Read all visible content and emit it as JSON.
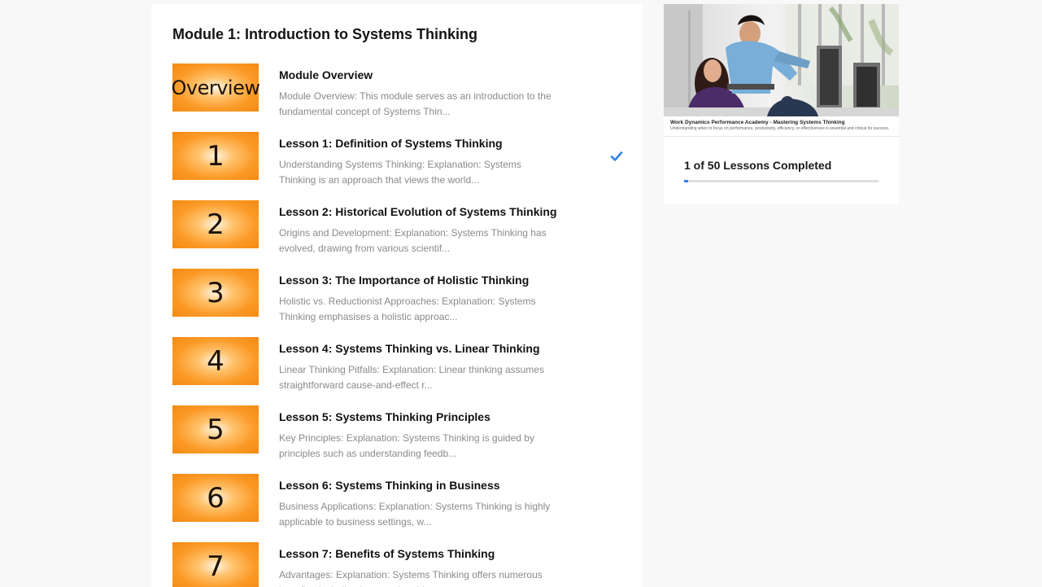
{
  "module": {
    "title": "Module 1: Introduction to Systems Thinking"
  },
  "lessons": [
    {
      "thumb_label": "Overview",
      "title": "Module Overview",
      "description": "Module Overview: This module serves as an introduction to the fundamental concept of Systems Thin...",
      "completed": false
    },
    {
      "thumb_label": "1",
      "title": "Lesson 1: Definition of Systems Thinking",
      "description": "Understanding Systems Thinking: Explanation: Systems Thinking is an approach that views the world...",
      "completed": true
    },
    {
      "thumb_label": "2",
      "title": "Lesson 2: Historical Evolution of Systems Thinking",
      "description": "Origins and Development: Explanation: Systems Thinking has evolved, drawing from various scientif...",
      "completed": false
    },
    {
      "thumb_label": "3",
      "title": "Lesson 3: The Importance of Holistic Thinking",
      "description": "Holistic vs. Reductionist Approaches: Explanation: Systems Thinking emphasises a holistic approac...",
      "completed": false
    },
    {
      "thumb_label": "4",
      "title": "Lesson 4: Systems Thinking vs. Linear Thinking",
      "description": "Linear Thinking Pitfalls: Explanation: Linear thinking assumes straightforward cause-and-effect r...",
      "completed": false
    },
    {
      "thumb_label": "5",
      "title": "Lesson 5: Systems Thinking Principles",
      "description": "Key Principles: Explanation: Systems Thinking is guided by principles such as understanding feedb...",
      "completed": false
    },
    {
      "thumb_label": "6",
      "title": "Lesson 6: Systems Thinking in Business",
      "description": "Business Applications: Explanation: Systems Thinking is highly applicable to business settings, w...",
      "completed": false
    },
    {
      "thumb_label": "7",
      "title": "Lesson 7: Benefits of Systems Thinking",
      "description": "Advantages: Explanation: Systems Thinking offers numerous benefits, including improved problem-so...",
      "completed": false
    }
  ],
  "course": {
    "image_caption_title": "Work Dynamics Performance Academy - Mastering Systems Thinking",
    "image_caption_subtitle": "Understanding when to focus on performance, productivity, efficiency, or effectiveness is essential and critical for success.",
    "progress_text": "1 of 50 Lessons Completed",
    "lessons_completed": 1,
    "lessons_total": 50
  },
  "colors": {
    "thumbnail_orange": "#f28a12",
    "check_blue": "#2f80ed",
    "progress_blue": "#2f80ed"
  },
  "icons": {
    "completed": "check-icon"
  }
}
